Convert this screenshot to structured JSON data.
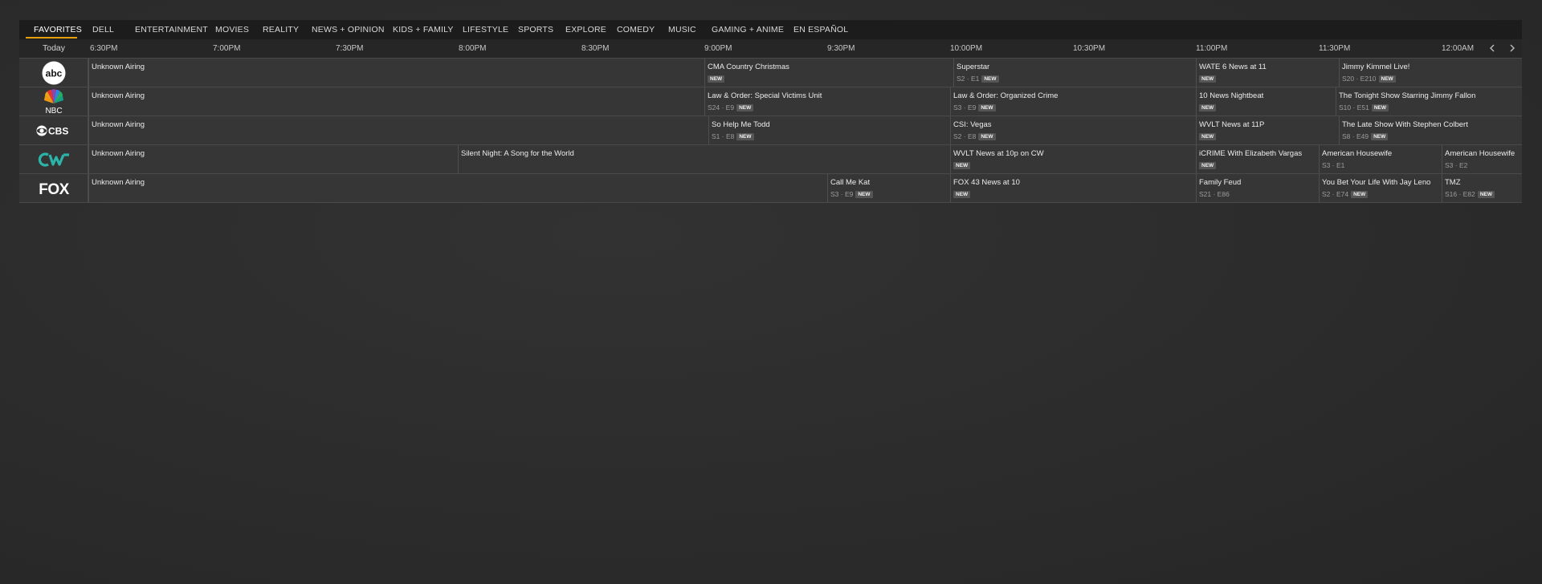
{
  "categories": [
    {
      "label": "FAVORITES",
      "active": true
    },
    {
      "label": "DELL"
    },
    {
      "label": "ENTERTAINMENT"
    },
    {
      "label": "MOVIES"
    },
    {
      "label": "REALITY"
    },
    {
      "label": "NEWS + OPINION"
    },
    {
      "label": "KIDS + FAMILY"
    },
    {
      "label": "LIFESTYLE"
    },
    {
      "label": "SPORTS"
    },
    {
      "label": "EXPLORE"
    },
    {
      "label": "COMEDY"
    },
    {
      "label": "MUSIC"
    },
    {
      "label": "GAMING + ANIME"
    },
    {
      "label": "EN ESPAÑOL"
    }
  ],
  "timeline": {
    "day_label": "Today",
    "times": [
      "6:30PM",
      "7:00PM",
      "7:30PM",
      "8:00PM",
      "8:30PM",
      "9:00PM",
      "9:30PM",
      "10:00PM",
      "10:30PM",
      "11:00PM",
      "11:30PM",
      "12:00AM"
    ],
    "prev_icon": "chevron-left-icon",
    "next_icon": "chevron-right-icon"
  },
  "badge_label": "NEW",
  "channels": [
    {
      "name": "abc",
      "logo_icon": "abc-logo-icon",
      "programs": [
        {
          "title": "Unknown Airing",
          "meta": "",
          "is_new": false
        },
        {
          "title": "CMA Country Christmas",
          "meta": "",
          "is_new": true
        },
        {
          "title": "Superstar",
          "meta": "S2 · E1",
          "is_new": true
        },
        {
          "title": "WATE 6 News at 11",
          "meta": "",
          "is_new": true
        },
        {
          "title": "Jimmy Kimmel Live!",
          "meta": "S20 · E210",
          "is_new": true
        }
      ]
    },
    {
      "name": "NBC",
      "logo_icon": "nbc-peacock-logo-icon",
      "programs": [
        {
          "title": "Unknown Airing",
          "meta": "",
          "is_new": false
        },
        {
          "title": "Law & Order: Special Victims Unit",
          "meta": "S24 · E9",
          "is_new": true
        },
        {
          "title": "Law & Order: Organized Crime",
          "meta": "S3 · E9",
          "is_new": true
        },
        {
          "title": "10 News Nightbeat",
          "meta": "",
          "is_new": true
        },
        {
          "title": "The Tonight Show Starring Jimmy Fallon",
          "meta": "S10 · E51",
          "is_new": true
        }
      ]
    },
    {
      "name": "CBS",
      "logo_icon": "cbs-eye-logo-icon",
      "programs": [
        {
          "title": "Unknown Airing",
          "meta": "",
          "is_new": false
        },
        {
          "title": "So Help Me Todd",
          "meta": "S1 · E8",
          "is_new": true
        },
        {
          "title": "CSI: Vegas",
          "meta": "S2 · E8",
          "is_new": true
        },
        {
          "title": "WVLT News at 11P",
          "meta": "",
          "is_new": true
        },
        {
          "title": "The Late Show With Stephen Colbert",
          "meta": "S8 · E49",
          "is_new": true
        }
      ]
    },
    {
      "name": "CW",
      "logo_icon": "cw-logo-icon",
      "programs": [
        {
          "title": "Unknown Airing",
          "meta": "",
          "is_new": false
        },
        {
          "title": "Silent Night: A Song for the World",
          "meta": "",
          "is_new": false
        },
        {
          "title": "WVLT News at 10p on CW",
          "meta": "",
          "is_new": true
        },
        {
          "title": "iCRIME With Elizabeth Vargas",
          "meta": "",
          "is_new": true
        },
        {
          "title": "American Housewife",
          "meta": "S3 · E1",
          "is_new": false
        },
        {
          "title": "American Housewife",
          "meta": "S3 · E2",
          "is_new": false
        }
      ]
    },
    {
      "name": "FOX",
      "logo_icon": "fox-logo-icon",
      "programs": [
        {
          "title": "Unknown Airing",
          "meta": "",
          "is_new": false
        },
        {
          "title": "Call Me Kat",
          "meta": "S3 · E9",
          "is_new": true
        },
        {
          "title": "FOX 43 News at 10",
          "meta": "",
          "is_new": true
        },
        {
          "title": "Family Feud",
          "meta": "S21 · E86",
          "is_new": false
        },
        {
          "title": "You Bet Your Life With Jay Leno",
          "meta": "S2 · E74",
          "is_new": true
        },
        {
          "title": "TMZ",
          "meta": "S16 · E82",
          "is_new": true
        }
      ]
    }
  ]
}
